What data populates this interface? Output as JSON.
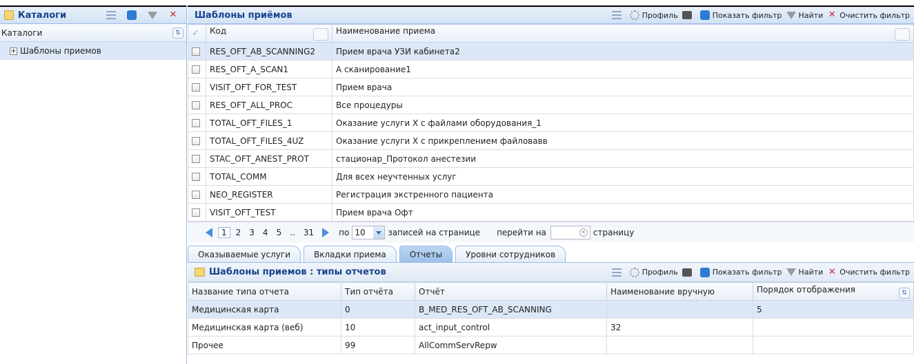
{
  "left_panel": {
    "title": "Каталоги",
    "column_header": "Каталоги",
    "tree_items": [
      {
        "label": "Шаблоны приемов"
      }
    ]
  },
  "main_panel": {
    "title": "Шаблоны приёмов",
    "toolbar": {
      "profile": "Профиль",
      "show_filter": "Показать фильтр",
      "find": "Найти",
      "clear_filter": "Очистить фильтр"
    },
    "columns": {
      "code": "Код",
      "name": "Наименование приема"
    },
    "rows": [
      {
        "code": "RES_OFT_AB_SCANNING2",
        "name": "Прием врача УЗИ кабинета2"
      },
      {
        "code": "RES_OFT_A_SCAN1",
        "name": "А сканирование1"
      },
      {
        "code": "VISIT_OFT_FOR_TEST",
        "name": "Прием врача"
      },
      {
        "code": "RES_OFT_ALL_PROC",
        "name": "Все процедуры"
      },
      {
        "code": "TOTAL_OFT_FILES_1",
        "name": "Оказание услуги Х с файлами оборудования_1"
      },
      {
        "code": "TOTAL_OFT_FILES_4UZ",
        "name": "Оказание услуги Х с прикреплением файловавв"
      },
      {
        "code": "STAC_OFT_ANEST_PROT",
        "name": "стационар_Протокол анестезии"
      },
      {
        "code": "TOTAL_COMM",
        "name": "Для всех неучтенных услуг"
      },
      {
        "code": "NEO_REGISTER",
        "name": "Регистрация экстренного пациента"
      },
      {
        "code": "VISIT_OFT_TEST",
        "name": "Прием врача Офт"
      }
    ],
    "pager": {
      "pages": [
        "1",
        "2",
        "3",
        "4",
        "5",
        "..",
        "31"
      ],
      "current_page": "1",
      "per_page_prefix": "по",
      "per_page_value": "10",
      "per_page_suffix": "записей на странице",
      "goto_prefix": "перейти на",
      "goto_suffix": "страницу"
    }
  },
  "tabs": [
    {
      "label": "Оказываемые услуги",
      "active": false
    },
    {
      "label": "Вкладки приема",
      "active": false
    },
    {
      "label": "Отчеты",
      "active": true
    },
    {
      "label": "Уровни сотрудников",
      "active": false
    }
  ],
  "reports_panel": {
    "title": "Шаблоны приемов : типы отчетов",
    "toolbar": {
      "profile": "Профиль",
      "show_filter": "Показать фильтр",
      "find": "Найти",
      "clear_filter": "Очистить фильтр"
    },
    "columns": {
      "type_name": "Название типа отчета",
      "type": "Тип отчёта",
      "report": "Отчёт",
      "manual_name": "Наименование вручную",
      "order": "Порядок отображения"
    },
    "rows": [
      {
        "type_name": "Медицинская карта",
        "type": "0",
        "report": "B_MED_RES_OFT_AB_SCANNING",
        "manual_name": "",
        "order": "5"
      },
      {
        "type_name": "Медицинская карта (веб)",
        "type": "10",
        "report": "act_input_control",
        "manual_name": "32",
        "order": ""
      },
      {
        "type_name": "Прочее",
        "type": "99",
        "report": "AllCommServRepw",
        "manual_name": "",
        "order": ""
      }
    ]
  }
}
